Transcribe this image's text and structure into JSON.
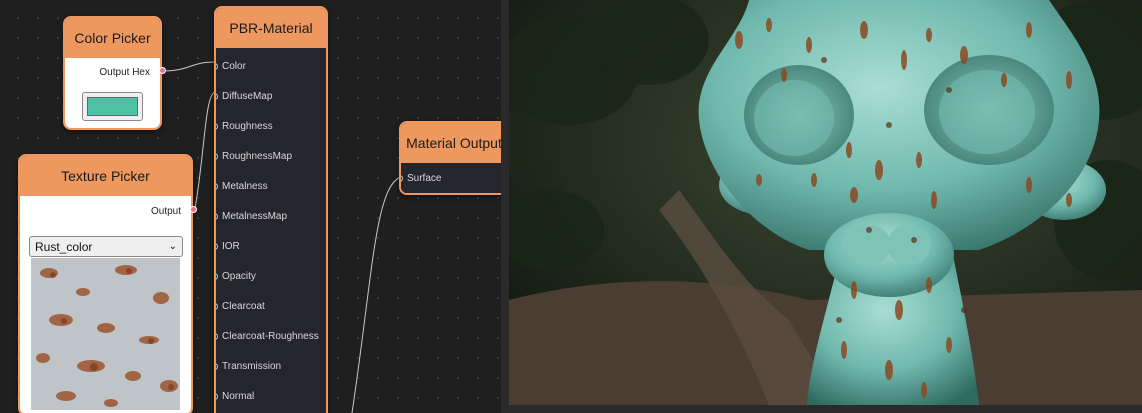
{
  "nodes": {
    "color_picker": {
      "title": "Color Picker",
      "output_label": "Output Hex",
      "swatch_color": "#4ec2a6"
    },
    "texture_picker": {
      "title": "Texture Picker",
      "output_label": "Output",
      "selected_texture": "Rust_color"
    },
    "pbr_material": {
      "title": "PBR-Material",
      "inputs": [
        "Color",
        "DiffuseMap",
        "Roughness",
        "RoughnessMap",
        "Metalness",
        "MetalnessMap",
        "IOR",
        "Opacity",
        "Clearcoat",
        "Clearcoat-Roughness",
        "Transmission",
        "Normal"
      ]
    },
    "material_output": {
      "title": "Material Output",
      "input_label": "Surface"
    }
  },
  "colors": {
    "node_header": "#ee9860",
    "output_socket": "#ec6f86",
    "input_socket_ring": "#9fd4dc",
    "wire": "#c8c8c8",
    "model_surface": "#6fb8ad"
  },
  "viewport": {
    "model": "monkey-head",
    "material_look": "teal-with-rust"
  }
}
